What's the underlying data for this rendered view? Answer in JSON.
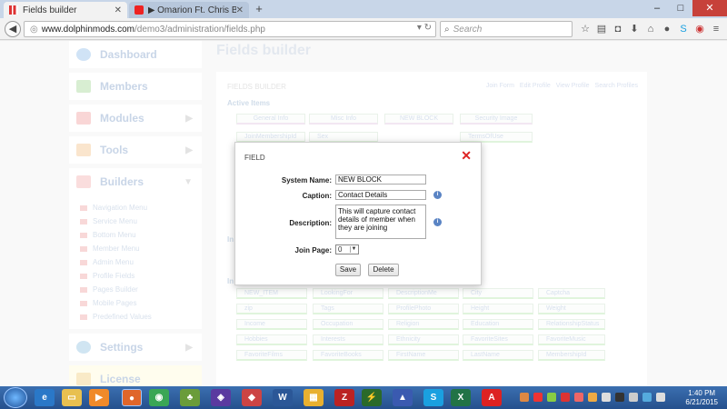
{
  "browser": {
    "tabs": [
      {
        "label": "Fields builder",
        "active": true
      },
      {
        "label": "▶ Omarion Ft. Chris Brown...",
        "active": false
      }
    ],
    "new_tab": "+",
    "window_controls": [
      "–",
      "□",
      "✕"
    ],
    "url_host": "www.dolphinmods.com",
    "url_path": "/demo3/administration/fields.php",
    "search_placeholder": "Search"
  },
  "sidebar": {
    "items": [
      {
        "label": "Dashboard",
        "icon": "dashboard-icon",
        "color": "#7ab6e6"
      },
      {
        "label": "Members",
        "icon": "members-icon",
        "color": "#8fce7a"
      },
      {
        "label": "Modules",
        "icon": "modules-icon",
        "color": "#f08b8b"
      },
      {
        "label": "Tools",
        "icon": "wrench-icon",
        "color": "#f0b070"
      },
      {
        "label": "Builders",
        "icon": "builders-icon",
        "color": "#f29c9c"
      }
    ],
    "builders_sub": [
      "Navigation Menu",
      "Service Menu",
      "Bottom Menu",
      "Member Menu",
      "Admin Menu",
      "Profile Fields",
      "Pages Builder",
      "Mobile Pages",
      "Predefined Values"
    ],
    "settings": "Settings",
    "license": "License"
  },
  "main": {
    "title": "Fields builder",
    "panel_head": "FIELDS BUILDER",
    "links": [
      "Join Form",
      "Edit Profile",
      "View Profile",
      "Search Profiles"
    ],
    "active_label": "Active Items",
    "active_groups": [
      "General Info",
      "Misc Info",
      "NEW BLOCK",
      "Security Image"
    ],
    "active_fields": [
      "JoinMembershipId",
      "Sex",
      "TermsOfUse"
    ],
    "inactive_label_1": "In",
    "inactive_label_2": "In",
    "inactive_rows": [
      [
        "NEW_ITEM",
        "LookingFor",
        "DescriptionMe",
        "City",
        "Captcha"
      ],
      [
        "zip",
        "Tags",
        "ProfilePhoto",
        "Height",
        "Weight"
      ],
      [
        "Income",
        "Occupation",
        "Religion",
        "Education",
        "RelationshipStatus"
      ],
      [
        "Hobbies",
        "Interests",
        "Ethnicity",
        "FavoriteSites",
        "FavoriteMusic"
      ],
      [
        "FavoriteFilms",
        "FavoriteBooks",
        "FirstName",
        "LastName",
        "MembershipId"
      ]
    ]
  },
  "dialog": {
    "title": "FIELD",
    "close": "✕",
    "system_name_label": "System Name:",
    "system_name_value": "NEW BLOCK",
    "caption_label": "Caption:",
    "caption_value": "Contact Details",
    "description_label": "Description:",
    "description_value": "This will capture contact details of member when they are joining",
    "join_page_label": "Join Page:",
    "join_page_value": "0",
    "save_label": "Save",
    "delete_label": "Delete",
    "info_glyph": "i"
  },
  "taskbar": {
    "time": "1:40 PM",
    "date": "6/21/2015"
  }
}
